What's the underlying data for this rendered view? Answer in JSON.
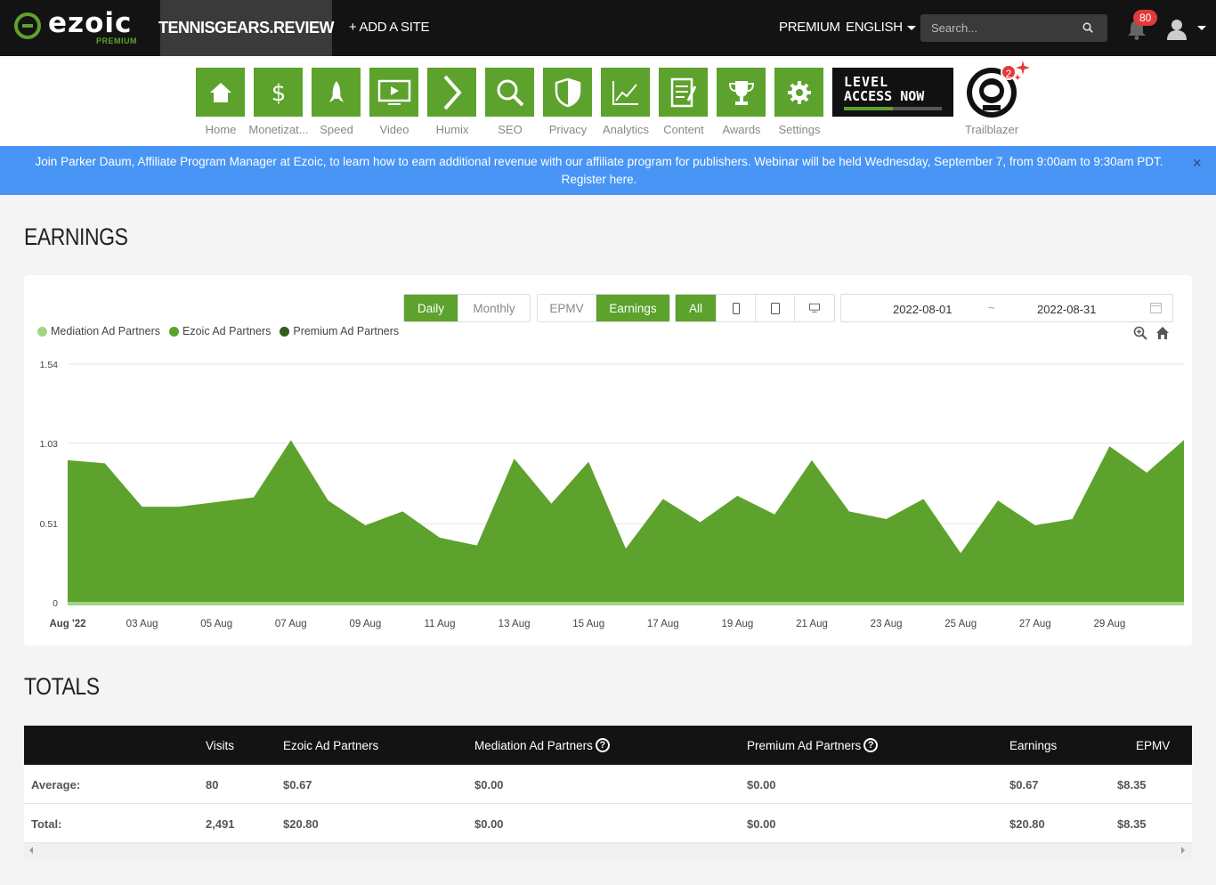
{
  "topbar": {
    "logo_text": "ezoic",
    "logo_sub": "PREMIUM",
    "site_name": "TENNISGEARS.REVIEW",
    "add_site": "+ ADD A SITE",
    "premium": "PREMIUM",
    "language": "ENGLISH",
    "search_placeholder": "Search...",
    "notification_count": "80"
  },
  "iconnav": {
    "items": [
      {
        "label": "Home",
        "icon": "home-icon"
      },
      {
        "label": "Monetizat...",
        "icon": "dollar-icon"
      },
      {
        "label": "Speed",
        "icon": "rocket-icon"
      },
      {
        "label": "Video",
        "icon": "video-play-icon"
      },
      {
        "label": "Humix",
        "icon": "chevron-right-icon"
      },
      {
        "label": "SEO",
        "icon": "magnifier-icon"
      },
      {
        "label": "Privacy",
        "icon": "shield-icon"
      },
      {
        "label": "Analytics",
        "icon": "line-graph-icon"
      },
      {
        "label": "Content",
        "icon": "document-edit-icon"
      },
      {
        "label": "Awards",
        "icon": "trophy-icon"
      },
      {
        "label": "Settings",
        "icon": "gear-icon"
      }
    ],
    "level_line1": "LEVEL",
    "level_line2": "ACCESS NOW",
    "level_progress": 0.5,
    "trailblazer_label": "Trailblazer",
    "trailblazer_badge": "2"
  },
  "announcement": {
    "text": "Join Parker Daum, Affiliate Program Manager at Ezoic, to learn how to earn additional revenue with our affiliate program for publishers. Webinar will be held Wednesday, September 7, from 9:00am to 9:30am PDT.",
    "link_text": "Register here.",
    "close": "×"
  },
  "earnings": {
    "title": "EARNINGS",
    "period_buttons": [
      "Daily",
      "Monthly"
    ],
    "metric_buttons": [
      "EPMV",
      "Earnings"
    ],
    "device_all": "All",
    "date_start": "2022-08-01",
    "date_sep": "~",
    "date_end": "2022-08-31"
  },
  "chart_data": {
    "type": "area",
    "x_labels": [
      "Aug '22",
      "03 Aug",
      "05 Aug",
      "07 Aug",
      "09 Aug",
      "11 Aug",
      "13 Aug",
      "15 Aug",
      "17 Aug",
      "19 Aug",
      "21 Aug",
      "23 Aug",
      "25 Aug",
      "27 Aug",
      "29 Aug"
    ],
    "y_ticks": [
      "1.54",
      "1.03",
      "0.51",
      "0"
    ],
    "ylim": [
      0,
      1.54
    ],
    "x": [
      1,
      2,
      3,
      4,
      5,
      6,
      7,
      8,
      9,
      10,
      11,
      12,
      13,
      14,
      15,
      16,
      17,
      18,
      19,
      20,
      21,
      22,
      23,
      24,
      25,
      26,
      27,
      28,
      29,
      30,
      31
    ],
    "series": [
      {
        "name": "Mediation Ad Partners",
        "color": "#9fd584",
        "values": [
          0,
          0,
          0,
          0,
          0,
          0,
          0,
          0,
          0,
          0,
          0,
          0,
          0,
          0,
          0,
          0,
          0,
          0,
          0,
          0,
          0,
          0,
          0,
          0,
          0,
          0,
          0,
          0,
          0,
          0,
          0
        ]
      },
      {
        "name": "Ezoic Ad Partners",
        "color": "#5ca22c",
        "values": [
          0.92,
          0.9,
          0.62,
          0.62,
          0.65,
          0.68,
          1.05,
          0.66,
          0.5,
          0.59,
          0.42,
          0.37,
          0.93,
          0.64,
          0.91,
          0.35,
          0.67,
          0.52,
          0.69,
          0.57,
          0.92,
          0.59,
          0.54,
          0.67,
          0.32,
          0.66,
          0.5,
          0.54,
          1.01,
          0.84,
          1.05
        ]
      },
      {
        "name": "Premium Ad Partners",
        "color": "#2f5e1a",
        "values": [
          0,
          0,
          0,
          0,
          0,
          0,
          0,
          0,
          0,
          0,
          0,
          0,
          0,
          0,
          0,
          0,
          0,
          0,
          0,
          0,
          0,
          0,
          0,
          0,
          0,
          0,
          0,
          0,
          0,
          0,
          0
        ]
      }
    ],
    "grid": true,
    "legend_position": "top-left"
  },
  "totals": {
    "title": "TOTALS",
    "columns": [
      "",
      "Visits",
      "Ezoic Ad Partners",
      "Mediation Ad Partners",
      "Premium Ad Partners",
      "Earnings",
      "EPMV"
    ],
    "rows": [
      [
        "Average:",
        "80",
        "$0.67",
        "$0.00",
        "$0.00",
        "$0.67",
        "$8.35"
      ],
      [
        "Total:",
        "2,491",
        "$20.80",
        "$0.00",
        "$0.00",
        "$20.80",
        "$8.35"
      ]
    ]
  }
}
